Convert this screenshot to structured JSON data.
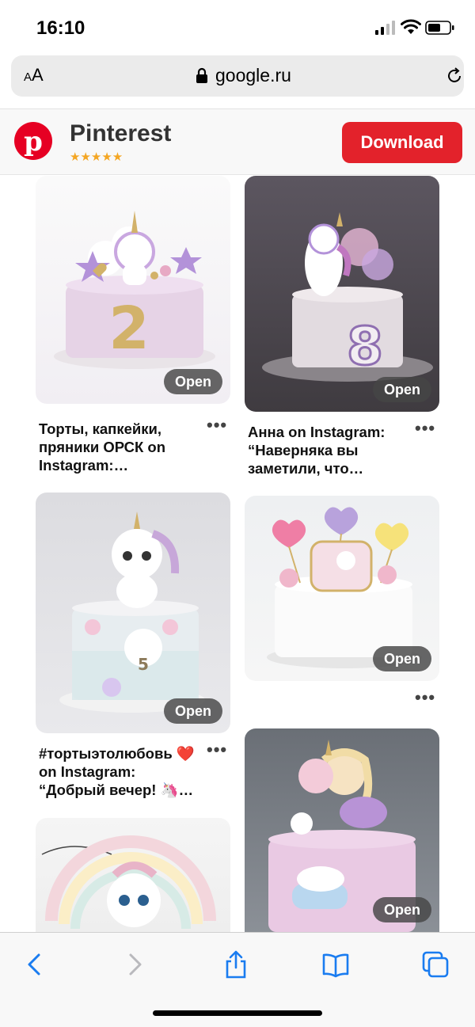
{
  "status_bar": {
    "time": "16:10"
  },
  "address_bar": {
    "text_size_small": "A",
    "text_size_large": "A",
    "url": "google.ru"
  },
  "banner": {
    "app_name": "Pinterest",
    "rating_stars": "★★★★★",
    "download_label": "Download"
  },
  "pins": [
    {
      "title": "Торты, капкейки, пряники ОРСК on Instagram:…",
      "open_label": "Open",
      "more": "•••",
      "image_text": "2"
    },
    {
      "title": "Анна on Instagram: “Наверняка вы заметили, что…",
      "open_label": "Open",
      "more": "•••",
      "image_text": "8"
    },
    {
      "title": "#тортыэтолюбовь ❤️ on Instagram: “Добрый вечер! 🦄…",
      "open_label": "Open",
      "more": "•••",
      "image_text": "5"
    },
    {
      "title": "",
      "open_label": "Open",
      "more": "•••"
    },
    {
      "title": "",
      "open_label": "",
      "more": ""
    },
    {
      "title": "",
      "open_label": "Open",
      "more": ""
    }
  ],
  "toolbar": {
    "back": "back-icon",
    "forward": "forward-icon",
    "share": "share-icon",
    "bookmarks": "book-icon",
    "tabs": "tabs-icon"
  },
  "colors": {
    "pinterest_red": "#e60023",
    "download_red": "#e3222b",
    "star": "#f4a623"
  }
}
